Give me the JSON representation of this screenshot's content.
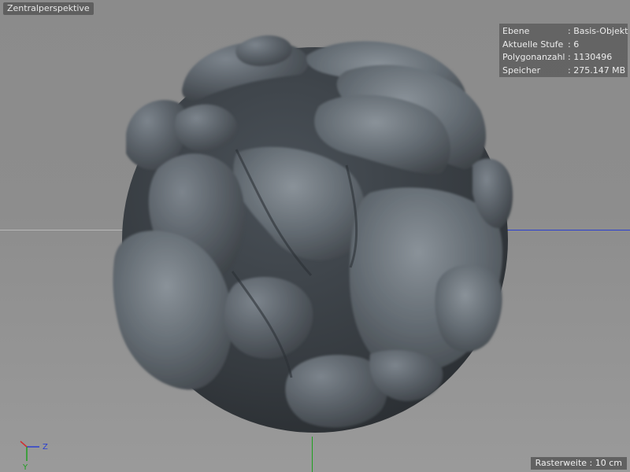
{
  "viewport": {
    "camera_label": "Zentralperspektive",
    "grid_label": "Rasterweite : 10 cm"
  },
  "info_panel": {
    "rows": [
      {
        "key": "Ebene",
        "value": ": Basis-Objekt"
      },
      {
        "key": "Aktuelle Stufe",
        "value": ": 6"
      },
      {
        "key": "Polygonanzahl",
        "value": ": 1130496"
      },
      {
        "key": "Speicher",
        "value": ": 275.147 MB"
      }
    ]
  },
  "axes": {
    "z_label": "Z",
    "y_label": "Y",
    "colors": {
      "x": "#b0b0b0",
      "y": "#1fa01f",
      "z": "#2a3fd0"
    }
  },
  "colors": {
    "background": "#8c8c8c",
    "object_dark": "#3f454b",
    "object_light": "#6b737b"
  }
}
